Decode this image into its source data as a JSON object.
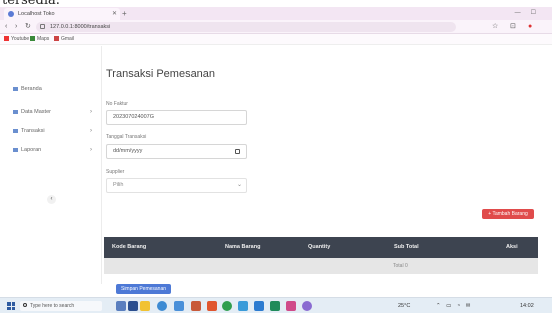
{
  "cropped_heading": "tersedia.",
  "browser": {
    "tab_title": "Localhost Toko",
    "url": "127.0.0.1:8000/transaksi",
    "bookmarks": [
      "Youtube",
      "Maps",
      "Gmail"
    ]
  },
  "sidebar": {
    "items": [
      {
        "label": "Beranda",
        "has_chevron": false
      },
      {
        "label": "Data Master",
        "has_chevron": true
      },
      {
        "label": "Transaksi",
        "has_chevron": true
      },
      {
        "label": "Laporan",
        "has_chevron": true
      }
    ]
  },
  "main": {
    "title": "Transaksi Pemesanan",
    "fields": {
      "no_faktur": {
        "label": "No Faktur",
        "value": "202307024007G"
      },
      "tanggal": {
        "label": "Tanggal Transaksi",
        "value": "dd/mm/yyyy"
      },
      "supplier": {
        "label": "Supplier",
        "value": "Pilih"
      }
    },
    "add_button": "+ Tambah Barang",
    "table": {
      "columns": [
        "Kode Barang",
        "Nama Barang",
        "Quantity",
        "Sub Total",
        "Aksi"
      ],
      "total_label": "Total 0"
    },
    "save_button": "Simpan Pemesanan"
  },
  "taskbar": {
    "search_placeholder": "Type here to search",
    "tray_text": "25°C",
    "time": "14:02"
  },
  "colors": {
    "table_header": "#3d4450",
    "add_button": "#e04b4b",
    "save_button": "#4d79d6",
    "sidebar_icon": "#6a8fcf"
  }
}
